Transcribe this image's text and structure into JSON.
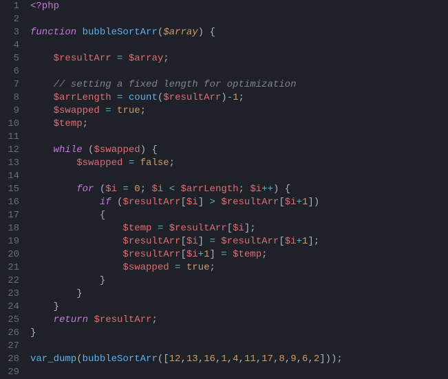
{
  "code": {
    "language": "php",
    "lines": 29,
    "tokens": {
      "l1_open": "<?php",
      "l3_fn": "function",
      "l3_name": "bubbleSortArr",
      "l3_param": "$array",
      "l5_var": "$resultArr",
      "l5_rhs": "$array",
      "l7_comment": "// setting a fixed length for optimization",
      "l8_var": "$arrLength",
      "l8_call": "count",
      "l8_arg": "$resultArr",
      "l8_minus1": "1",
      "l9_var": "$swapped",
      "l9_true": "true",
      "l10_var": "$temp",
      "l12_while": "while",
      "l12_cond": "$swapped",
      "l13_var": "$swapped",
      "l13_false": "false",
      "l15_for": "for",
      "l15_i": "$i",
      "l15_zero": "0",
      "l15_i2": "$i",
      "l15_len": "$arrLength",
      "l15_i3": "$i",
      "l16_if": "if",
      "l16_ra1": "$resultArr",
      "l16_i1": "$i",
      "l16_ra2": "$resultArr",
      "l16_i2": "$i",
      "l16_plus1": "1",
      "l18_temp": "$temp",
      "l18_ra": "$resultArr",
      "l18_i": "$i",
      "l19_ra1": "$resultArr",
      "l19_i1": "$i",
      "l19_ra2": "$resultArr",
      "l19_i2": "$i",
      "l19_plus1": "1",
      "l20_ra": "$resultArr",
      "l20_i": "$i",
      "l20_plus1": "1",
      "l20_temp": "$temp",
      "l21_var": "$swapped",
      "l21_true": "true",
      "l25_return": "return",
      "l25_var": "$resultArr",
      "l28_dump": "var_dump",
      "l28_call": "bubbleSortArr",
      "l28_nums": [
        "12",
        "13",
        "16",
        "1",
        "4",
        "11",
        "17",
        "8",
        "9",
        "6",
        "2"
      ]
    },
    "source": "<?php\n\nfunction bubbleSortArr($array) {\n\n    $resultArr = $array;\n\n    // setting a fixed length for optimization\n    $arrLength = count($resultArr)-1;\n    $swapped = true;\n    $temp;\n\n    while ($swapped) {\n        $swapped = false;\n\n        for ($i = 0; $i < $arrLength; $i++) {\n            if ($resultArr[$i] > $resultArr[$i+1])\n            {\n                $temp = $resultArr[$i];\n                $resultArr[$i] = $resultArr[$i+1];\n                $resultArr[$i+1] = $temp;\n                $swapped = true;\n            }\n        }\n    }\n    return $resultArr;\n}\n\nvar_dump(bubbleSortArr([12,13,16,1,4,11,17,8,9,6,2]));\n"
  }
}
